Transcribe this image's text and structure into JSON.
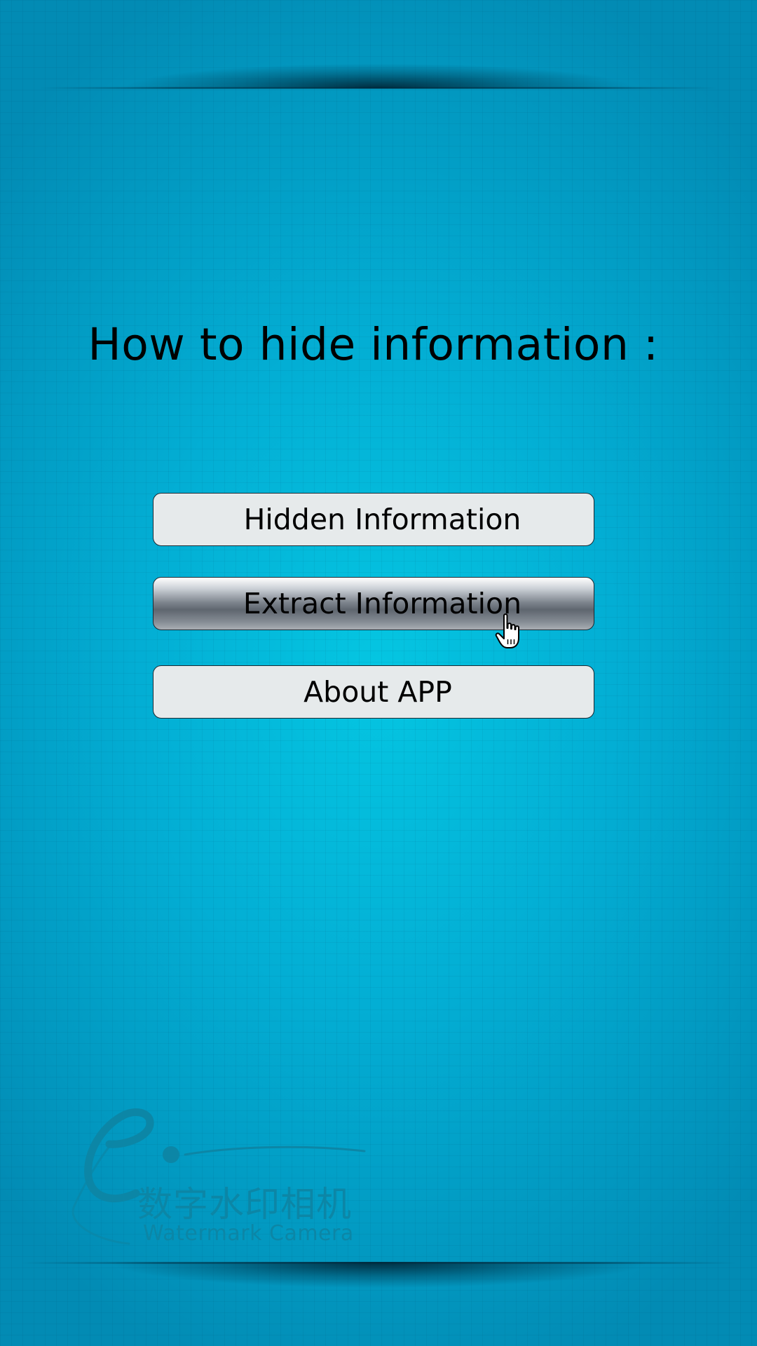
{
  "title": "How to hide information :",
  "buttons": {
    "hidden": "Hidden Information",
    "extract": "Extract Information",
    "about": "About APP"
  },
  "logo": {
    "chinese": "数字水印相机",
    "english": "Watermark Camera"
  },
  "colors": {
    "background": "#03aed4",
    "button_bg": "#e6eaeb",
    "button_pressed": "#6a717a",
    "logo_text": "#0c86a6"
  },
  "icons": {
    "cursor": "hand-pointer-icon",
    "logo": "e-logo-icon"
  }
}
